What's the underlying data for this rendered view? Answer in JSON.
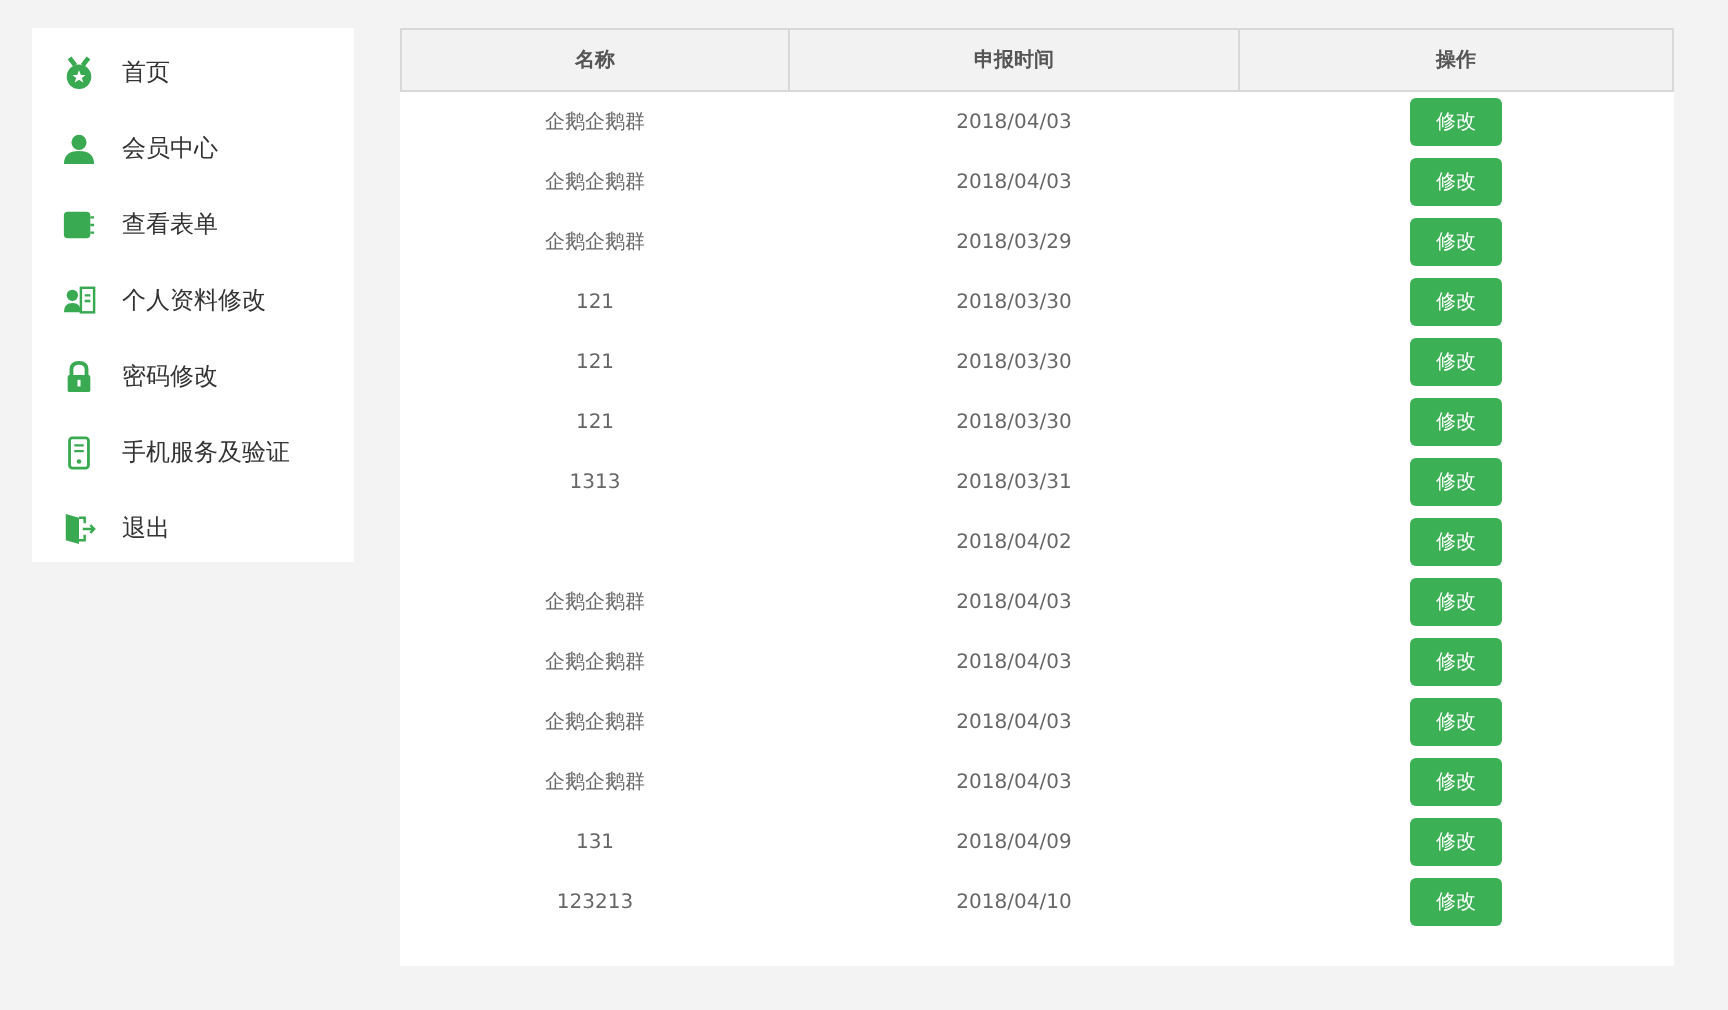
{
  "sidebar": {
    "items": [
      {
        "label": "首页",
        "kind": "medal"
      },
      {
        "label": "会员中心",
        "kind": "user"
      },
      {
        "label": "查看表单",
        "kind": "book"
      },
      {
        "label": "个人资料修改",
        "kind": "card"
      },
      {
        "label": "密码修改",
        "kind": "lock"
      },
      {
        "label": "手机服务及验证",
        "kind": "phone"
      },
      {
        "label": "退出",
        "kind": "exit"
      }
    ]
  },
  "table": {
    "columns": [
      "名称",
      "申报时间",
      "操作"
    ],
    "rows": [
      {
        "name": "企鹅企鹅群",
        "date": "2018/04/03",
        "action": "修改"
      },
      {
        "name": "企鹅企鹅群",
        "date": "2018/04/03",
        "action": "修改"
      },
      {
        "name": "企鹅企鹅群",
        "date": "2018/03/29",
        "action": "修改"
      },
      {
        "name": "121",
        "date": "2018/03/30",
        "action": "修改"
      },
      {
        "name": "121",
        "date": "2018/03/30",
        "action": "修改"
      },
      {
        "name": "121",
        "date": "2018/03/30",
        "action": "修改"
      },
      {
        "name": "1313",
        "date": "2018/03/31",
        "action": "修改"
      },
      {
        "date": "2018/04/02",
        "action": "修改"
      },
      {
        "name": "企鹅企鹅群",
        "date": "2018/04/03",
        "action": "修改"
      },
      {
        "name": "企鹅企鹅群",
        "date": "2018/04/03",
        "action": "修改"
      },
      {
        "name": "企鹅企鹅群",
        "date": "2018/04/03",
        "action": "修改"
      },
      {
        "name": "企鹅企鹅群",
        "date": "2018/04/03",
        "action": "修改"
      },
      {
        "name": "131",
        "date": "2018/04/09",
        "action": "修改"
      },
      {
        "name": "123213",
        "date": "2018/04/10",
        "action": "修改"
      }
    ]
  }
}
